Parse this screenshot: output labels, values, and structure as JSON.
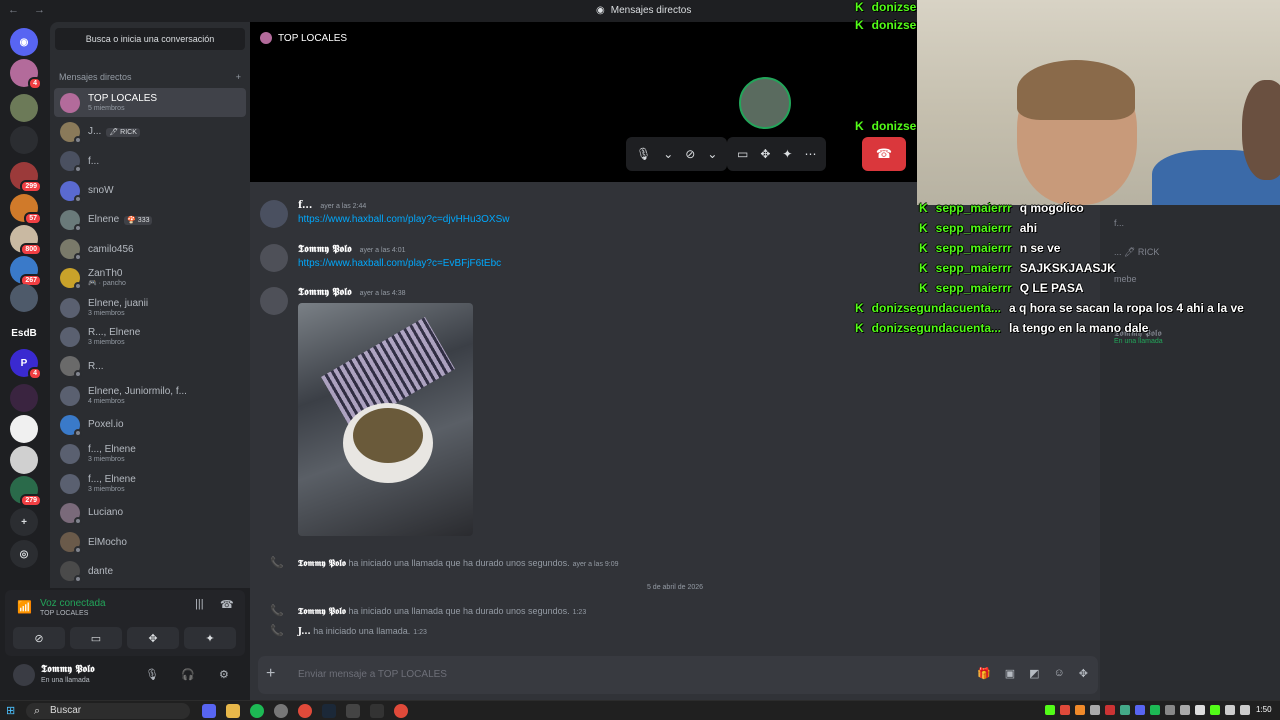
{
  "titlebar": {
    "title": "Mensajes directos",
    "nav": "←  →"
  },
  "servers": [
    {
      "name": "Discord",
      "badge": "",
      "color": "#5865f2",
      "glyph": "◉"
    },
    {
      "name": "avatar",
      "badge": "4",
      "color": "#b36b9b",
      "glyph": ""
    },
    {
      "name": "server-1",
      "badge": "",
      "color": "#6c7a58",
      "glyph": ""
    },
    {
      "name": "server-2",
      "badge": "",
      "color": "#2b2d31",
      "glyph": ""
    },
    {
      "name": "server-3",
      "badge": "299",
      "color": "#9b3a3a",
      "glyph": ""
    },
    {
      "name": "server-4",
      "badge": "57",
      "color": "#d07a2a",
      "glyph": ""
    },
    {
      "name": "server-5",
      "badge": "800",
      "color": "#c9b9a2",
      "glyph": ""
    },
    {
      "name": "server-6",
      "badge": "267",
      "color": "#3a7ac9",
      "glyph": ""
    },
    {
      "name": "server-7",
      "badge": "",
      "color": "#4e5a6a",
      "glyph": ""
    },
    {
      "name": "EsdB",
      "badge": "",
      "color": "#1e1f22",
      "glyph": "EsdB"
    },
    {
      "name": "server-8",
      "badge": "4",
      "color": "#3a2ad0",
      "glyph": "P"
    },
    {
      "name": "server-9",
      "badge": "",
      "color": "#3a2440",
      "glyph": ""
    },
    {
      "name": "server-10",
      "badge": "",
      "color": "#f0f0f0",
      "glyph": ""
    },
    {
      "name": "server-11",
      "badge": "",
      "color": "#d0d0d0",
      "glyph": ""
    },
    {
      "name": "server-12",
      "badge": "279",
      "color": "#2a6a4a",
      "glyph": ""
    }
  ],
  "dm_panel": {
    "search_label": "Busca o inicia una conversación",
    "header": "Mensajes directos",
    "add_glyph": "+",
    "items": [
      {
        "name": "TOP LOCALES",
        "sub": "5 miembros",
        "tag": "",
        "color": "#b36b9b",
        "active": true
      },
      {
        "name": "J...",
        "sub": "",
        "tag": "🖊 RICK",
        "color": "#8a7a5a",
        "active": false
      },
      {
        "name": "f...",
        "sub": "",
        "tag": "",
        "color": "#4a5060",
        "active": false
      },
      {
        "name": "snoW",
        "sub": "",
        "tag": "",
        "color": "#5a6ad0",
        "active": false
      },
      {
        "name": "Elnene",
        "sub": "",
        "tag": "🍄 333",
        "color": "#6a7a7a",
        "active": false
      },
      {
        "name": "camilo456",
        "sub": "",
        "tag": "",
        "color": "#7a7a6a",
        "active": false
      },
      {
        "name": "ZanTh0",
        "sub": "🎮 · pancho",
        "tag": "",
        "color": "#c9a22a",
        "active": false
      },
      {
        "name": "Elnene, juanii",
        "sub": "3 miembros",
        "tag": "",
        "color": "#5a6070",
        "active": false
      },
      {
        "name": "R..., Elnene",
        "sub": "3 miembros",
        "tag": "",
        "color": "#5a6070",
        "active": false
      },
      {
        "name": "R...",
        "sub": "",
        "tag": "",
        "color": "#6a6a6a",
        "active": false
      },
      {
        "name": "Elnene, Juniormilo, f...",
        "sub": "4 miembros",
        "tag": "",
        "color": "#5a6070",
        "active": false
      },
      {
        "name": "Poxel.io",
        "sub": "",
        "tag": "",
        "color": "#3a7ac9",
        "active": false
      },
      {
        "name": "f..., Elnene",
        "sub": "3 miembros",
        "tag": "",
        "color": "#5a6070",
        "active": false
      },
      {
        "name": "f..., Elnene",
        "sub": "3 miembros",
        "tag": "",
        "color": "#5a6070",
        "active": false
      },
      {
        "name": "Luciano",
        "sub": "",
        "tag": "",
        "color": "#7a6a7a",
        "active": false
      },
      {
        "name": "ElMocho",
        "sub": "",
        "tag": "",
        "color": "#6a5a4a",
        "active": false
      },
      {
        "name": "dante",
        "sub": "",
        "tag": "",
        "color": "#4a4a4a",
        "active": false
      }
    ]
  },
  "voice": {
    "status": "Voz conectada",
    "channel": "TOP LOCALES"
  },
  "user": {
    "name": "𝕿𝖔𝖒𝖒𝖞 𝕻𝖔𝖑𝖔",
    "status": "En una llamada"
  },
  "call": {
    "title": "TOP LOCALES"
  },
  "messages": [
    {
      "author": "f...",
      "time": "ayer a las 2:44",
      "link": "https://www.haxball.com/play?c=djvHHu3OXSw"
    },
    {
      "author": "𝕿𝖔𝖒𝖒𝖞 𝕻𝖔𝖑𝖔",
      "time": "ayer a las 4:01",
      "link": "https://www.haxball.com/play?c=EvBFjF6tEbc"
    },
    {
      "author": "𝕿𝖔𝖒𝖒𝖞 𝕻𝖔𝖑𝖔",
      "time": "ayer a las 4:38",
      "link": ""
    }
  ],
  "system": [
    {
      "author": "𝕿𝖔𝖒𝖒𝖞 𝕻𝖔𝖑𝖔",
      "text": "ha iniciado una llamada que ha durado unos segundos.",
      "time": "ayer a las 9:09"
    },
    {
      "author": "𝕿𝖔𝖒𝖒𝖞 𝕻𝖔𝖑𝖔",
      "text": "ha iniciado una llamada que ha durado unos segundos.",
      "time": "1:23"
    },
    {
      "author": "J...",
      "text": "ha iniciado una llamada.",
      "time": "1:23"
    }
  ],
  "date_divider": "5 de abril de 2026",
  "input": {
    "placeholder": "Enviar mensaje a TOP LOCALES"
  },
  "right_panel": {
    "items": [
      "f...",
      "... 🖊 RICK",
      "mebe",
      "𝕿𝖔𝖒𝖒𝖞 𝕻𝖔𝖑𝖔"
    ],
    "status": "En una llamada"
  },
  "stream_chat": [
    {
      "user": "donizse",
      "msg": ""
    },
    {
      "user": "donizse",
      "msg": ""
    },
    {
      "user": "donizse",
      "msg": ""
    },
    {
      "user": "sepp_maierrr",
      "msg": "q mogolico"
    },
    {
      "user": "sepp_maierrr",
      "msg": "ahi"
    },
    {
      "user": "sepp_maierrr",
      "msg": "n se ve"
    },
    {
      "user": "sepp_maierrr",
      "msg": "SAJKSKJAASJK"
    },
    {
      "user": "sepp_maierrr",
      "msg": "Q LE PASA"
    },
    {
      "user": "donizsegundacuenta...",
      "msg": "a q hora se sacan la ropa los 4 ahi a la ve"
    },
    {
      "user": "donizsegundacuenta...",
      "msg": "la tengo en la mano dale"
    }
  ],
  "taskbar": {
    "search": "Buscar",
    "clock": "1:50"
  }
}
